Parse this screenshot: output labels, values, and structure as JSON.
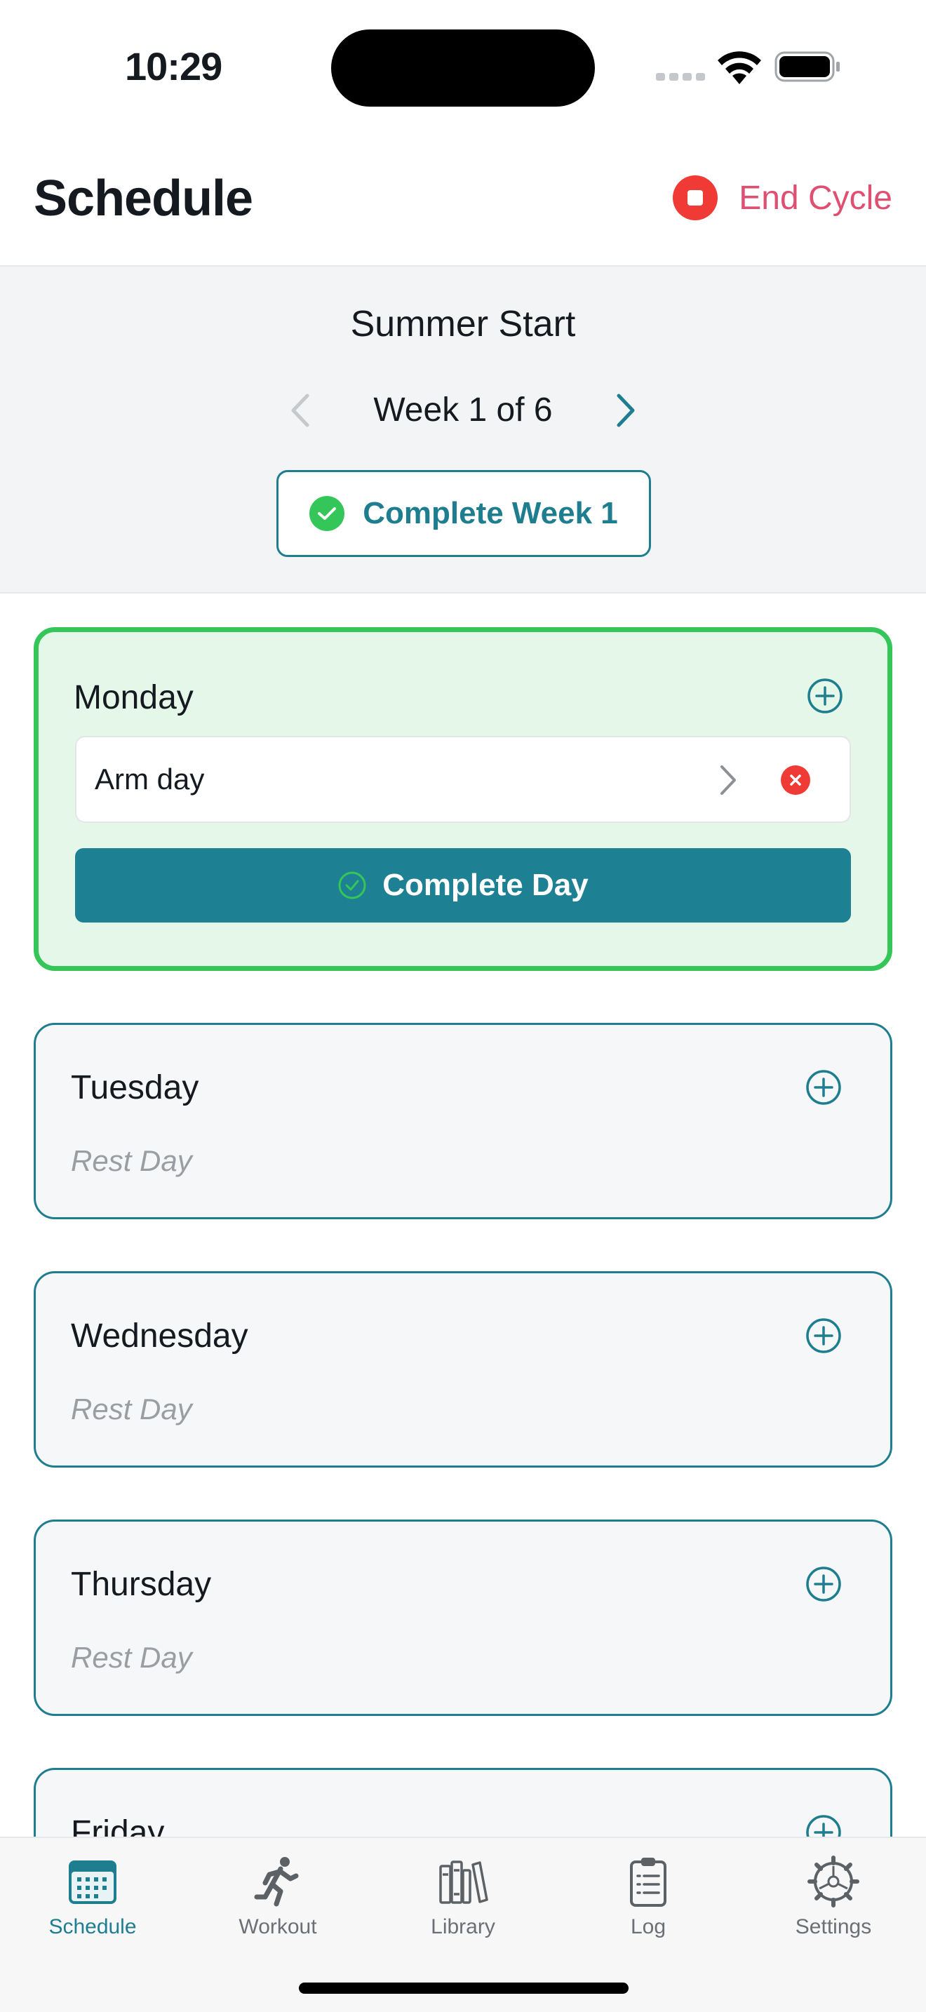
{
  "status_bar": {
    "time": "10:29"
  },
  "header": {
    "title": "Schedule",
    "end_cycle_label": "End Cycle"
  },
  "cycle": {
    "name": "Summer Start",
    "week_label": "Week 1 of 6",
    "complete_week_label": "Complete Week 1"
  },
  "days": {
    "monday": {
      "name": "Monday",
      "workout": "Arm day",
      "complete_label": "Complete Day"
    },
    "tuesday": {
      "name": "Tuesday",
      "rest_label": "Rest Day"
    },
    "wednesday": {
      "name": "Wednesday",
      "rest_label": "Rest Day"
    },
    "thursday": {
      "name": "Thursday",
      "rest_label": "Rest Day"
    },
    "friday": {
      "name": "Friday"
    }
  },
  "tabs": [
    {
      "label": "Schedule",
      "icon": "calendar-icon",
      "active": true
    },
    {
      "label": "Workout",
      "icon": "running-figure-icon",
      "active": false
    },
    {
      "label": "Library",
      "icon": "books-icon",
      "active": false
    },
    {
      "label": "Log",
      "icon": "clipboard-icon",
      "active": false
    },
    {
      "label": "Settings",
      "icon": "gear-icon",
      "active": false
    }
  ],
  "colors": {
    "accent": "#1e7e8f",
    "success": "#34c658",
    "danger": "#f03a35",
    "end_cycle_text": "#df4f72",
    "active_day_bg": "#e4f7e9"
  }
}
